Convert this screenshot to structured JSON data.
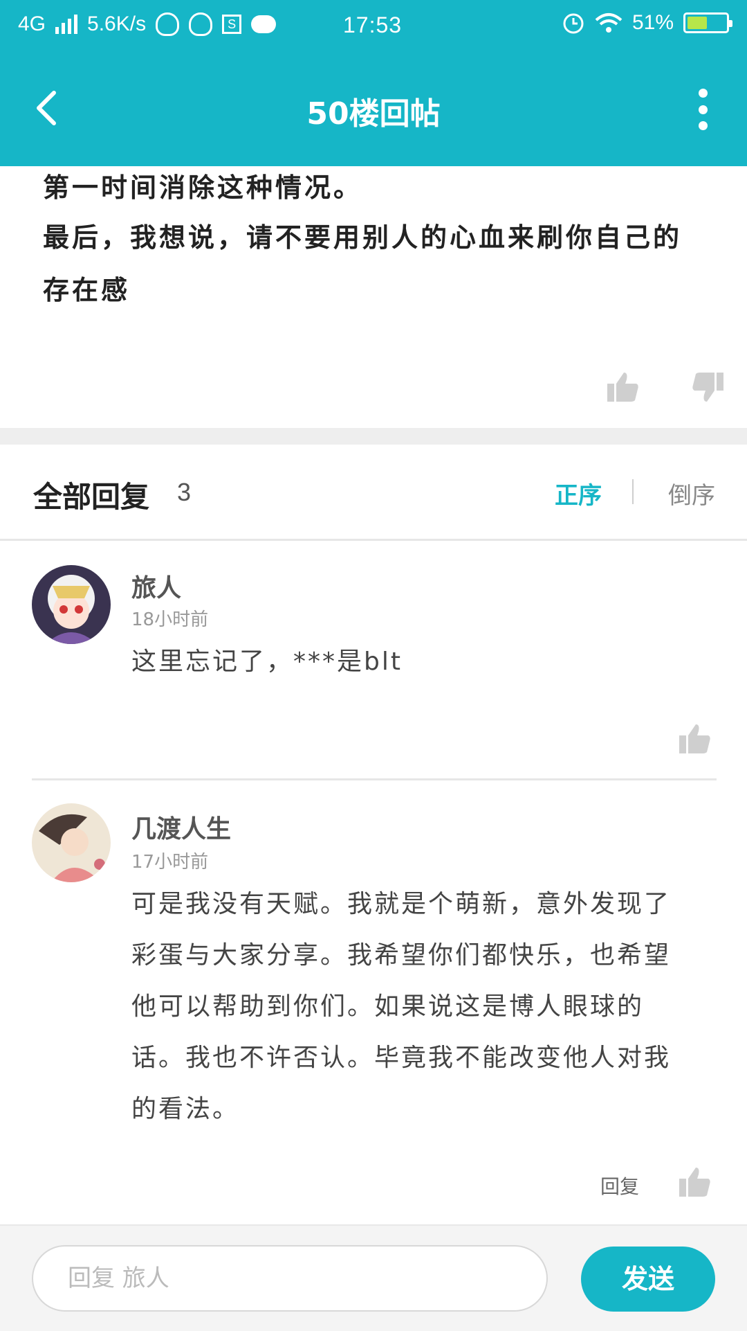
{
  "status_bar": {
    "network": "4G",
    "speed": "5.6K/s",
    "time": "17:53",
    "battery": "51%",
    "battery_level": 0.51
  },
  "nav": {
    "title": "50楼回帖",
    "back_icon": "back-arrow-icon",
    "more_icon": "more-vertical-icon"
  },
  "post": {
    "lines": [
      "第一时间消除这种情况。",
      "最后，我想说，请不要用别人的心血来刷你自己的",
      "存在感"
    ]
  },
  "replies_header": {
    "title": "全部回复",
    "count": "3",
    "sort_asc": "正序",
    "sort_desc": "倒序"
  },
  "replies": [
    {
      "name": "旅人",
      "time": "18小时前",
      "content": "这里忘记了，***是blt"
    },
    {
      "name": "几渡人生",
      "time": "17小时前",
      "content_lines": [
        "可是我没有天赋。我就是个萌新，意外发现了",
        "彩蛋与大家分享。我希望你们都快乐，也希望",
        "他可以帮助到你们。如果说这是博人眼球的",
        "话。我也不许否认。毕竟我不能改变他人对我",
        "的看法。"
      ],
      "reply_label": "回复"
    }
  ],
  "bottom": {
    "input_placeholder": "回复 旅人",
    "send_label": "发送"
  },
  "colors": {
    "accent": "#16b6c7",
    "thumb": "#cfcfcf"
  }
}
